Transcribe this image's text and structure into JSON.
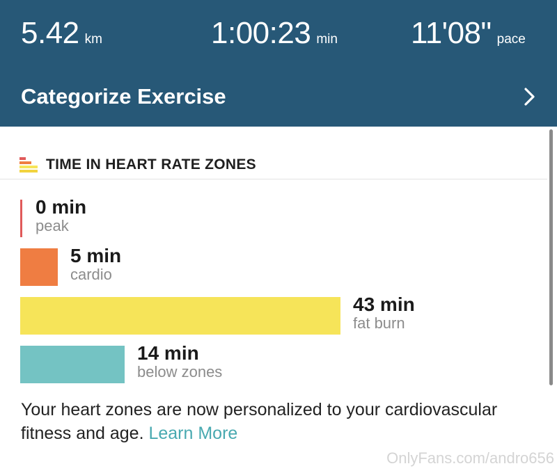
{
  "summary": {
    "distance": {
      "value": "5.42",
      "unit": "km"
    },
    "duration": {
      "value": "1:00:23",
      "unit": "min"
    },
    "pace": {
      "value": "11'08\"",
      "unit": "pace"
    }
  },
  "categorize": {
    "label": "Categorize Exercise",
    "icon": "chevron-right-icon"
  },
  "zones_card": {
    "title": "TIME IN HEART RATE ZONES",
    "icon": "heart-zones-icon",
    "zones": [
      {
        "minutes": "0 min",
        "name": "peak",
        "value": 0,
        "color": "#e05a5a"
      },
      {
        "minutes": "5 min",
        "name": "cardio",
        "value": 5,
        "color": "#ef7d42"
      },
      {
        "minutes": "43 min",
        "name": "fat burn",
        "value": 43,
        "color": "#f6e459"
      },
      {
        "minutes": "14 min",
        "name": "below zones",
        "value": 14,
        "color": "#74c3c3"
      }
    ]
  },
  "note": {
    "text": "Your heart zones are now personalized to your cardiovascular fitness and age.",
    "link": "Learn More"
  },
  "watermark": "OnlyFans.com/andro656",
  "colors": {
    "header_bg": "#275877",
    "link": "#48a9b0"
  }
}
